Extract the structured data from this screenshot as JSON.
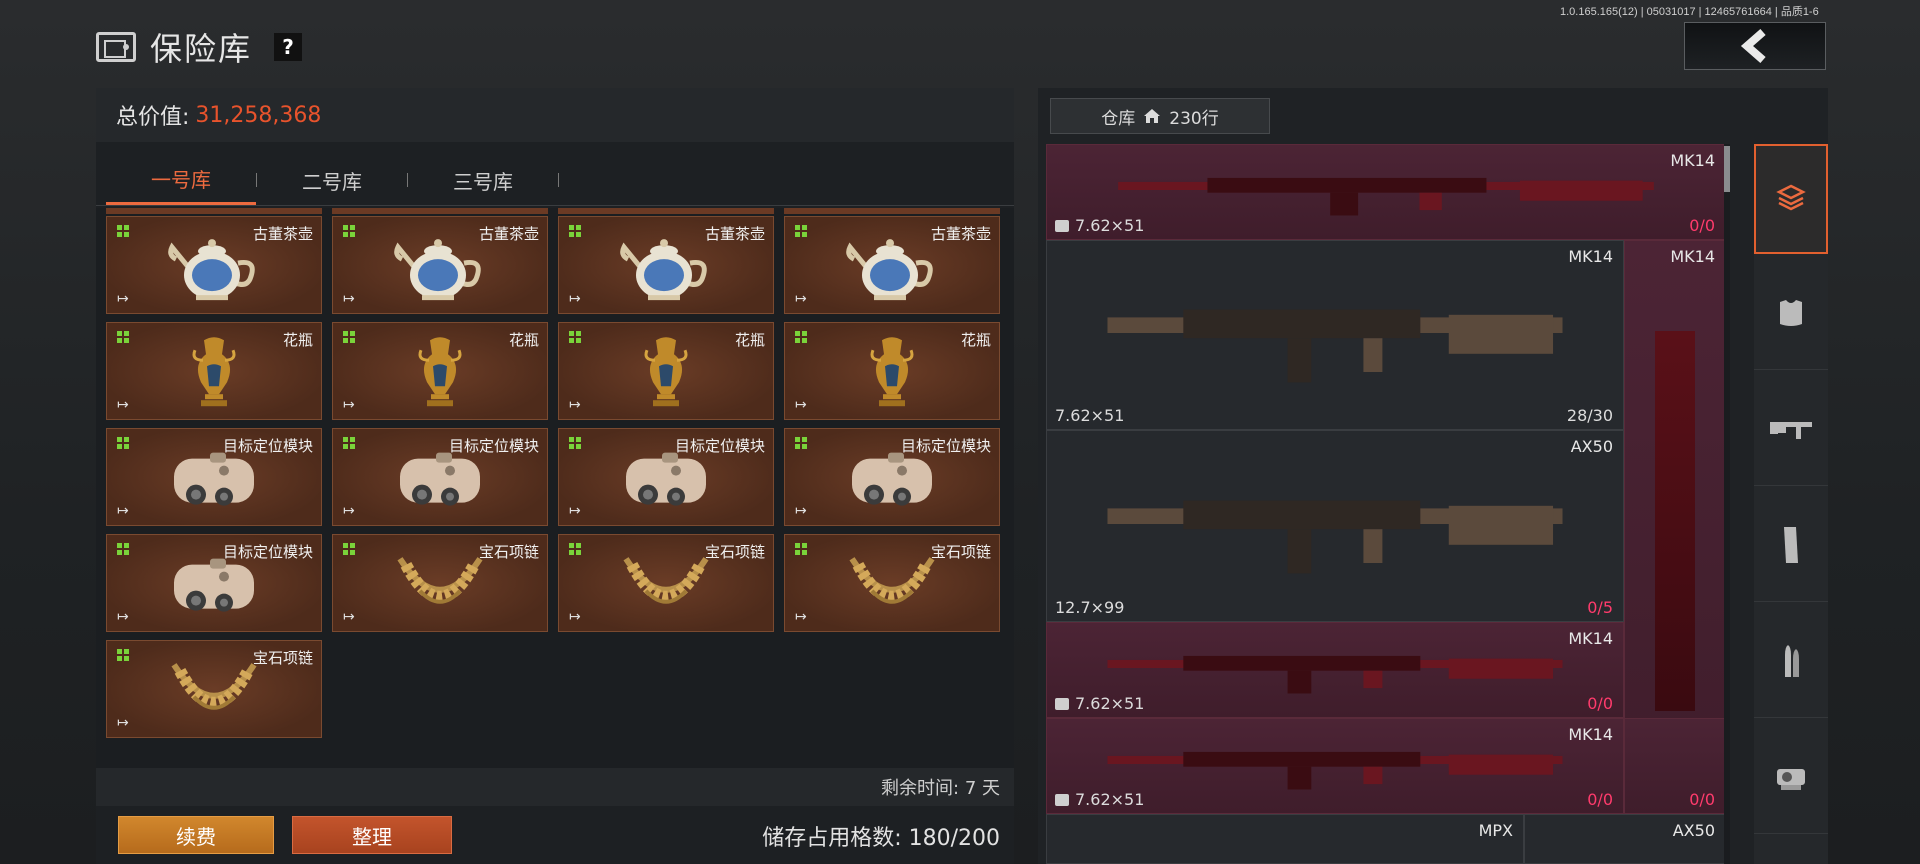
{
  "version": "1.0.165.165(12) | 05031017 | 12465761664 | 品质1-6",
  "header": {
    "title": "保险库",
    "help": "?"
  },
  "vault": {
    "total_label": "总价值:",
    "total_value": "31,258,368",
    "tabs": [
      {
        "label": "一号库",
        "active": true
      },
      {
        "label": "二号库",
        "active": false
      },
      {
        "label": "三号库",
        "active": false
      }
    ],
    "items": [
      {
        "name": "古董茶壶",
        "icon": "teapot-icon"
      },
      {
        "name": "古董茶壶",
        "icon": "teapot-icon"
      },
      {
        "name": "古董茶壶",
        "icon": "teapot-icon"
      },
      {
        "name": "古董茶壶",
        "icon": "teapot-icon"
      },
      {
        "name": "花瓶",
        "icon": "vase-icon"
      },
      {
        "name": "花瓶",
        "icon": "vase-icon"
      },
      {
        "name": "花瓶",
        "icon": "vase-icon"
      },
      {
        "name": "花瓶",
        "icon": "vase-icon"
      },
      {
        "name": "目标定位模块",
        "icon": "targeting-module-icon"
      },
      {
        "name": "目标定位模块",
        "icon": "targeting-module-icon"
      },
      {
        "name": "目标定位模块",
        "icon": "targeting-module-icon"
      },
      {
        "name": "目标定位模块",
        "icon": "targeting-module-icon"
      },
      {
        "name": "目标定位模块",
        "icon": "targeting-module-icon"
      },
      {
        "name": "宝石项链",
        "icon": "necklace-icon"
      },
      {
        "name": "宝石项链",
        "icon": "necklace-icon"
      },
      {
        "name": "宝石项链",
        "icon": "necklace-icon"
      },
      {
        "name": "宝石项链",
        "icon": "necklace-icon"
      }
    ],
    "remaining": "剩余时间: 7 天",
    "renew_label": "续费",
    "sort_label": "整理",
    "storage_text": "储存占用格数: 180/200"
  },
  "warehouse": {
    "tab_label": "仓库",
    "count_label": "230行",
    "weapons": [
      {
        "name": "MK14",
        "caliber": "7.62×51",
        "ammo_cur": "0",
        "ammo_max": "/0",
        "locked": true
      },
      {
        "name": "MK14",
        "caliber": "7.62×51",
        "ammo_cur": "28",
        "ammo_max": "/30",
        "locked": false
      },
      {
        "name": "MK14",
        "caliber": "",
        "ammo_cur": "",
        "ammo_max": "",
        "locked": false
      },
      {
        "name": "AX50",
        "caliber": "12.7×99",
        "ammo_cur": "0",
        "ammo_max": "/5",
        "locked": false
      },
      {
        "name": "MK14",
        "caliber": "7.62×51",
        "ammo_cur": "0",
        "ammo_max": "/0",
        "locked": true
      },
      {
        "name": "MK14",
        "caliber": "7.62×51",
        "ammo_cur": "0",
        "ammo_max": "/0",
        "locked": true
      },
      {
        "name": "",
        "caliber": "",
        "ammo_cur": "0",
        "ammo_max": "/0",
        "locked": false
      },
      {
        "name": "MPX",
        "caliber": "",
        "ammo_cur": "",
        "ammo_max": "",
        "locked": false
      },
      {
        "name": "AX50",
        "caliber": "",
        "ammo_cur": "",
        "ammo_max": "",
        "locked": false
      }
    ],
    "categories": [
      "layers-icon",
      "armor-vest-icon",
      "rifle-icon",
      "magazine-icon",
      "ammo-icon",
      "sight-icon"
    ]
  },
  "colors": {
    "accent": "#ec6a3f",
    "value": "#e8532c",
    "ammo_highlight": "#ff3b6c",
    "renew": "#c97a25",
    "sort": "#b74b25"
  }
}
